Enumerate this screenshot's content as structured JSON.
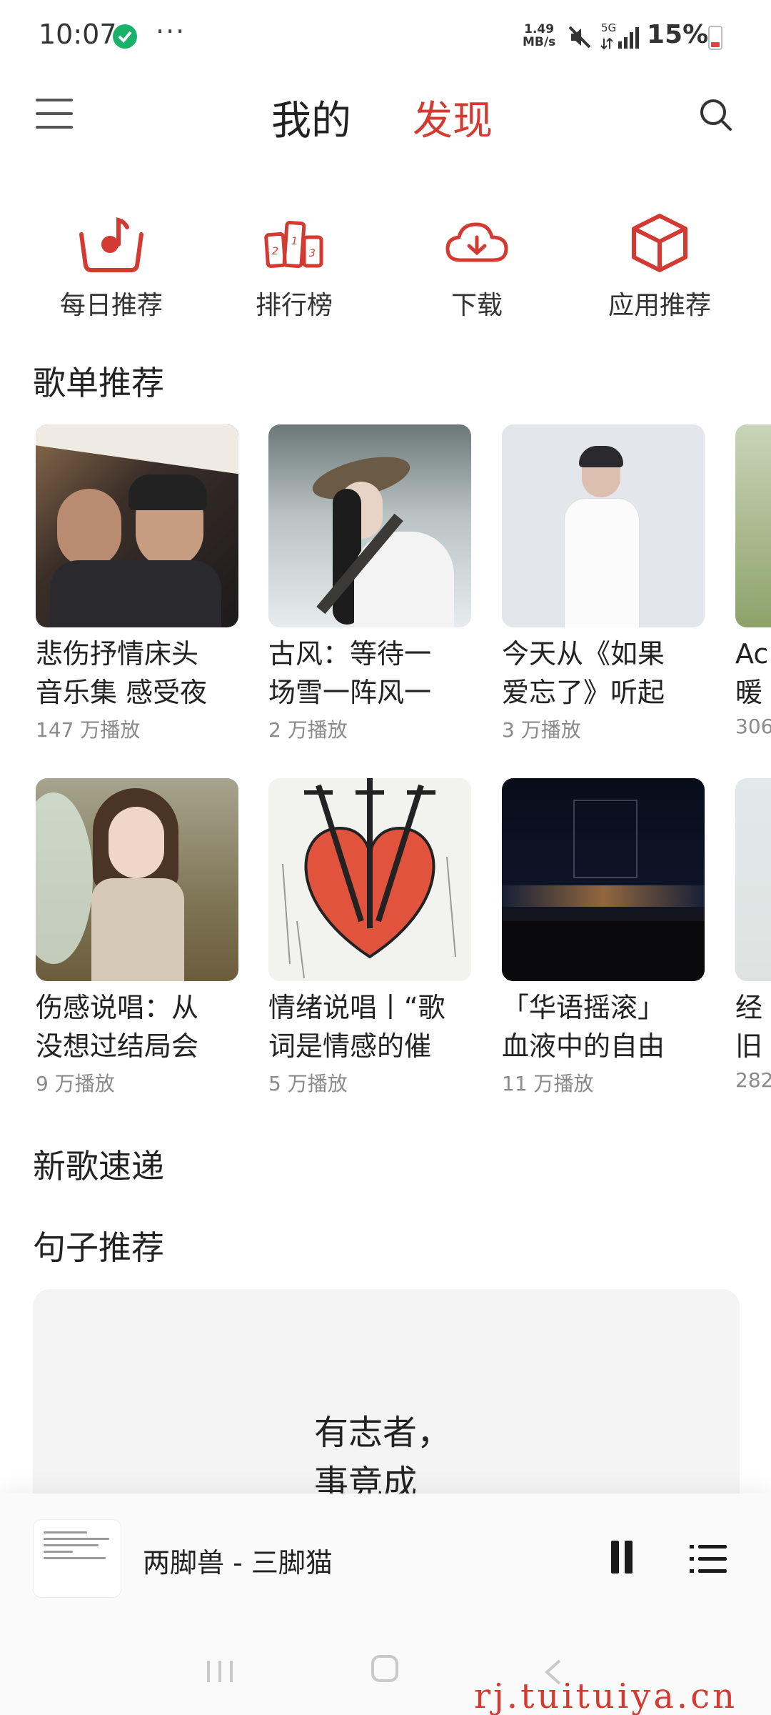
{
  "status": {
    "time": "10:07",
    "dots": "···",
    "speed_value": "1.49",
    "speed_unit": "MB/s",
    "network": "5G",
    "battery": "15%"
  },
  "header": {
    "tab_mine": "我的",
    "tab_discover": "发现",
    "active_tab_color": "#d33a31"
  },
  "quick": [
    {
      "label": "每日推荐",
      "icon": "daily-recommend-icon"
    },
    {
      "label": "排行榜",
      "icon": "rankings-icon"
    },
    {
      "label": "下载",
      "icon": "cloud-download-icon"
    },
    {
      "label": "应用推荐",
      "icon": "app-box-icon"
    }
  ],
  "sections": {
    "playlists": "歌单推荐",
    "new_songs": "新歌速递",
    "sentences": "句子推荐"
  },
  "playlists_row1": [
    {
      "title1": "悲伤抒情床头",
      "title2": "音乐集 感受夜",
      "plays": "147 万播放"
    },
    {
      "title1": "古风：等待一",
      "title2": "场雪一阵风一",
      "plays": "2 万播放"
    },
    {
      "title1": "今天从《如果",
      "title2": "爱忘了》听起",
      "plays": "3 万播放"
    },
    {
      "title1": "Ac",
      "title2": "暖",
      "plays": "306"
    }
  ],
  "playlists_row2": [
    {
      "title1": "伤感说唱：从",
      "title2": "没想过结局会",
      "plays": "9 万播放"
    },
    {
      "title1": "情绪说唱丨“歌",
      "title2": "词是情感的催",
      "plays": "5 万播放"
    },
    {
      "title1": "「华语摇滚」",
      "title2": "血液中的自由",
      "plays": "11 万播放"
    },
    {
      "title1": "经",
      "title2": "旧",
      "plays": "282"
    }
  ],
  "quote": {
    "line1": "有志者，",
    "line2": "事竟成"
  },
  "player": {
    "now_playing": "两脚兽 - 三脚猫"
  },
  "watermark": "rj.tuituiya.cn"
}
